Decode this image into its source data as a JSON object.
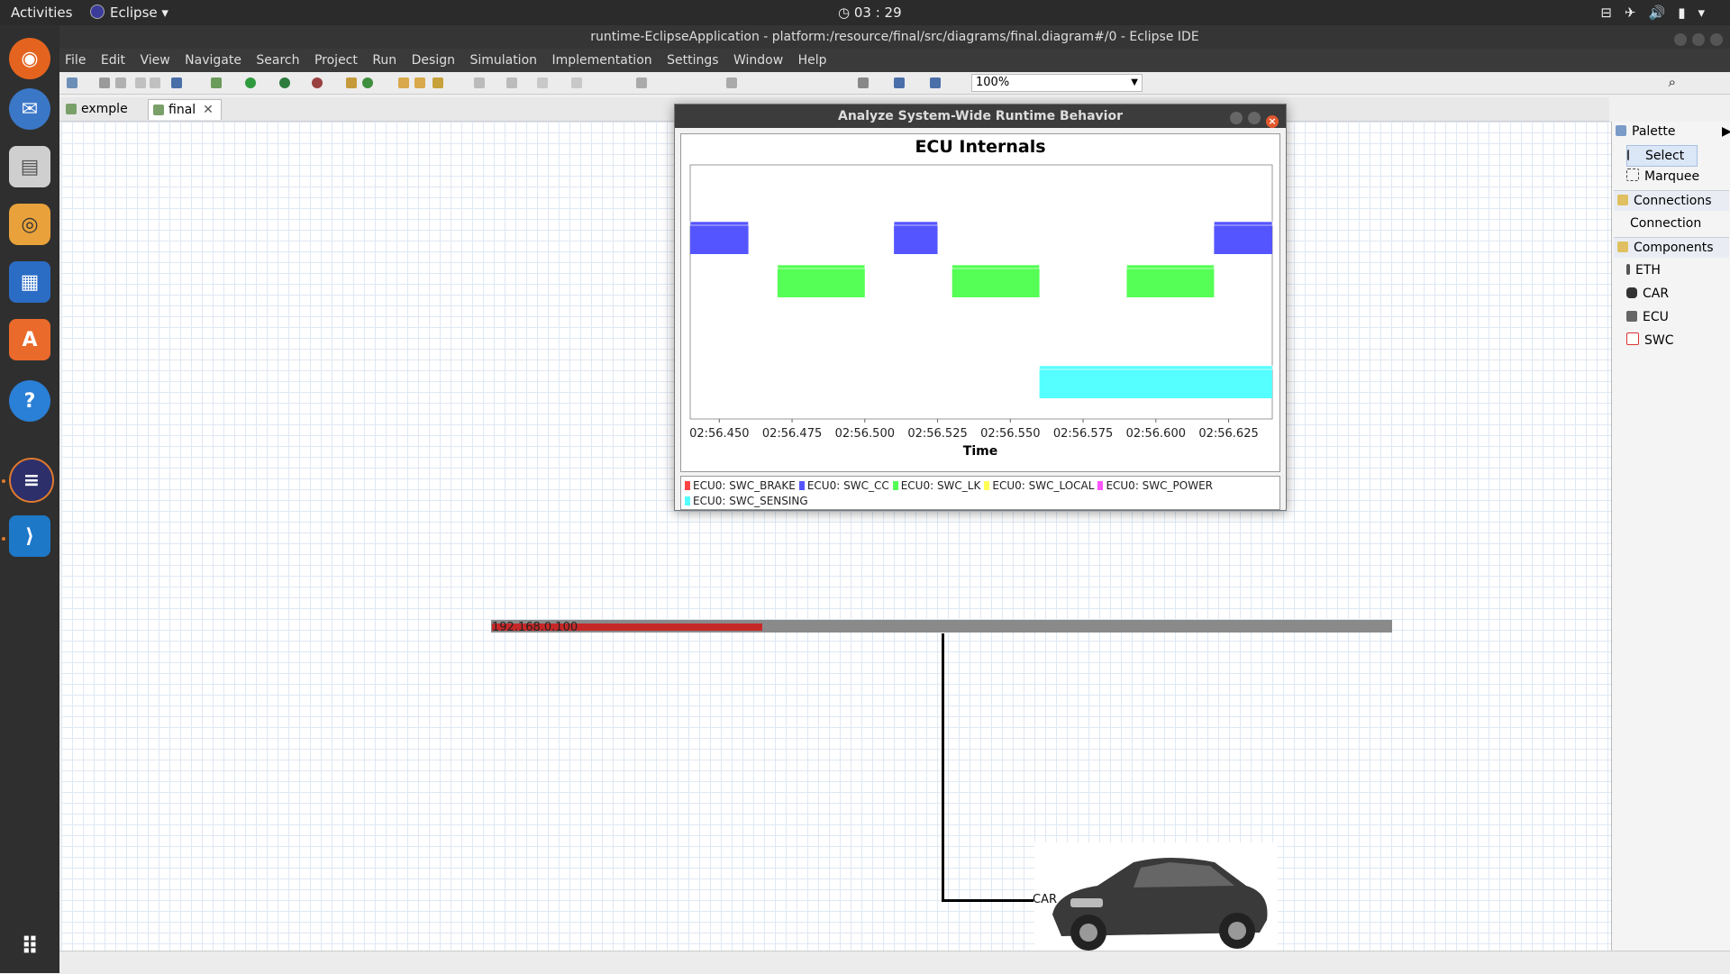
{
  "system": {
    "activities": "Activities",
    "app_name": "Eclipse",
    "clock": "03 : 29"
  },
  "window": {
    "title": "runtime-EclipseApplication - platform:/resource/final/src/diagrams/final.diagram#/0 - Eclipse IDE"
  },
  "menubar": [
    "File",
    "Edit",
    "View",
    "Navigate",
    "Search",
    "Project",
    "Run",
    "Design",
    "Simulation",
    "Implementation",
    "Settings",
    "Window",
    "Help"
  ],
  "toolbar": {
    "zoom": "100%"
  },
  "tabs": [
    {
      "label": "exmple"
    },
    {
      "label": "final",
      "active": true
    }
  ],
  "canvas": {
    "eth_ip": "192.168.0.100",
    "car_label": "CAR"
  },
  "palette": {
    "title": "Palette",
    "tools": [
      "Select",
      "Marquee"
    ],
    "connections_header": "Connections",
    "connections": [
      "Connection"
    ],
    "components_header": "Components",
    "components": [
      "ETH",
      "CAR",
      "ECU",
      "SWC"
    ]
  },
  "dialog": {
    "title": "Analyze System-Wide Runtime Behavior"
  },
  "chart_data": {
    "type": "bar",
    "title": "ECU Internals",
    "xlabel": "Time",
    "ylabel": "",
    "x_ticks": [
      "02:56.450",
      "02:56.475",
      "02:56.500",
      "02:56.525",
      "02:56.550",
      "02:56.575",
      "02:56.600",
      "02:56.625"
    ],
    "xlim": [
      "02:56.440",
      "02:56.640"
    ],
    "grid": false,
    "legend_position": "bottom",
    "series": [
      {
        "name": "ECU0: SWC_BRAKE",
        "color": "#ff4444",
        "lane": 0,
        "intervals": []
      },
      {
        "name": "ECU0: SWC_CC",
        "color": "#5555ff",
        "lane": 1,
        "intervals": [
          [
            "02:56.440",
            "02:56.460"
          ],
          [
            "02:56.510",
            "02:56.525"
          ],
          [
            "02:56.620",
            "02:56.640"
          ]
        ]
      },
      {
        "name": "ECU0: SWC_LK",
        "color": "#55ff55",
        "lane": 2,
        "intervals": [
          [
            "02:56.470",
            "02:56.500"
          ],
          [
            "02:56.530",
            "02:56.560"
          ],
          [
            "02:56.590",
            "02:56.620"
          ]
        ]
      },
      {
        "name": "ECU0: SWC_LOCAL",
        "color": "#ffff55",
        "lane": 3,
        "intervals": []
      },
      {
        "name": "ECU0: SWC_POWER",
        "color": "#ff55ff",
        "lane": 4,
        "intervals": []
      },
      {
        "name": "ECU0: SWC_SENSING",
        "color": "#55ffff",
        "lane": 5,
        "intervals": [
          [
            "02:56.560",
            "02:56.640"
          ]
        ]
      }
    ]
  }
}
